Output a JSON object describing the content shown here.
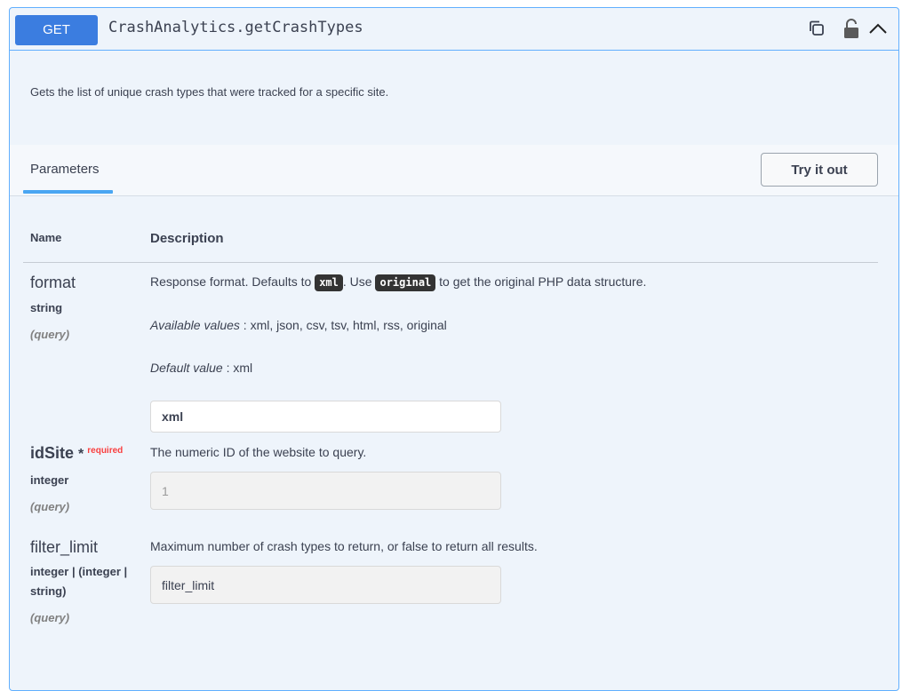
{
  "header": {
    "method": "GET",
    "path": "CrashAnalytics.getCrashTypes"
  },
  "icons": {
    "copy": "copy-icon",
    "lock": "unlock-icon",
    "collapse": "chevron-up-icon"
  },
  "description": "Gets the list of unique crash types that were tracked for a specific site.",
  "tabs": {
    "parameters": "Parameters"
  },
  "try_it_out_label": "Try it out",
  "columns": {
    "name": "Name",
    "description": "Description"
  },
  "params": {
    "format": {
      "name": "format",
      "type": "string",
      "in": "(query)",
      "desc_before": "Response format. Defaults to ",
      "code1": "xml",
      "desc_middle": ". Use ",
      "code2": "original",
      "desc_after": " to get the original PHP data structure.",
      "available_label": "Available values",
      "available_values": " : xml, json, csv, tsv, html, rss, original",
      "default_label": "Default value",
      "default_value": " : xml",
      "input_value": "xml"
    },
    "idSite": {
      "name": "idSite",
      "star": "*",
      "required": "required",
      "type": "integer",
      "in": "(query)",
      "desc": "The numeric ID of the website to query.",
      "placeholder": "1"
    },
    "filter_limit": {
      "name": "filter_limit",
      "type_line1": "integer | (integer |",
      "type_line2": "string)",
      "in": "(query)",
      "desc": "Maximum number of crash types to return, or false to return all results.",
      "input_value": "filter_limit"
    }
  },
  "colors": {
    "method_bg": "#3b7de0",
    "border": "#61affe",
    "panel_bg": "#eef4fb",
    "required": "#f93e3e",
    "tab_underline": "#49a6f2"
  }
}
